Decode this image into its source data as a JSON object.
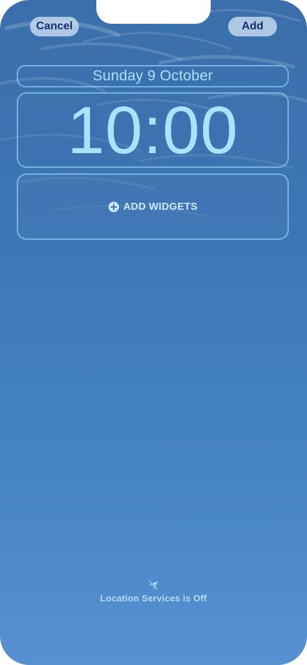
{
  "header": {
    "cancel_label": "Cancel",
    "add_label": "Add"
  },
  "lockscreen": {
    "date": "Sunday 9 October",
    "time": "10:00",
    "add_widgets_label": "ADD WIDGETS"
  },
  "footer": {
    "location_status": "Location Services is Off"
  },
  "icons": {
    "add_widgets": "plus-circle-icon",
    "location": "location-off-icon"
  },
  "colors": {
    "wallpaper_top": "#3a6fab",
    "wallpaper_bottom": "#5791d0",
    "clock_text": "#a9e2ff",
    "button_bg": "#c8dcf0",
    "button_text": "#1b2f6e"
  }
}
